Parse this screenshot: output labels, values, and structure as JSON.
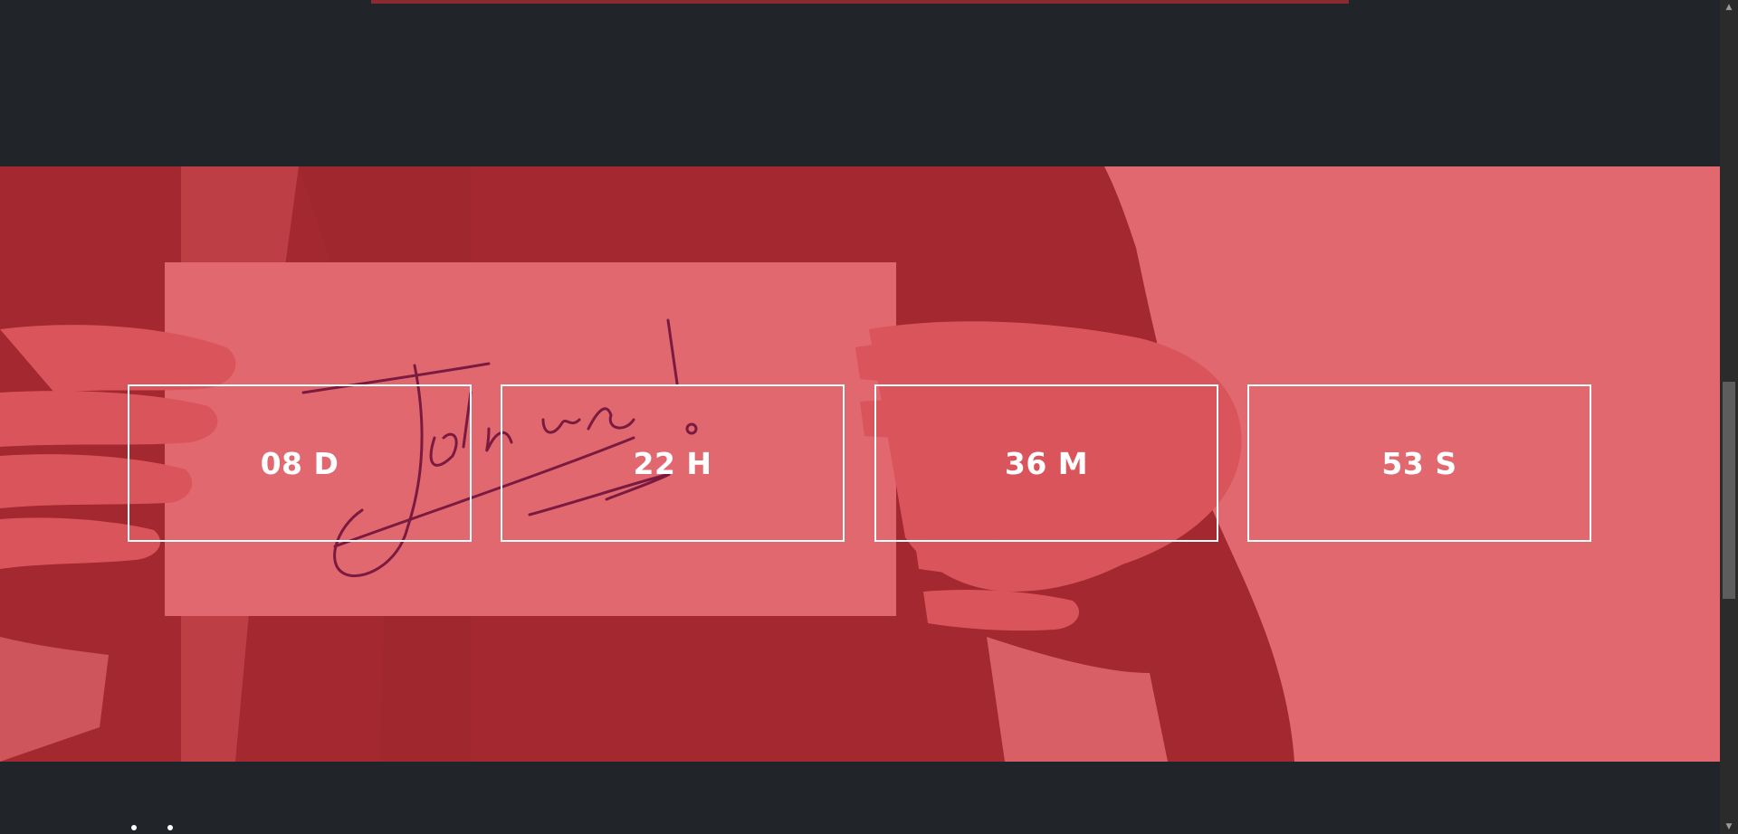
{
  "countdown": {
    "days": "08 D",
    "hours": "22 H",
    "minutes": "36 M",
    "seconds": "53 S"
  },
  "hero": {
    "note_text": "Join us!"
  },
  "scrollbar": {
    "up_arrow": "▲",
    "down_arrow": "▼"
  },
  "colors": {
    "background": "#212529",
    "hero_overlay": "#e0686e",
    "hero_dark": "#a3282f",
    "counter_border": "#ffffff",
    "counter_text": "#ffffff"
  }
}
